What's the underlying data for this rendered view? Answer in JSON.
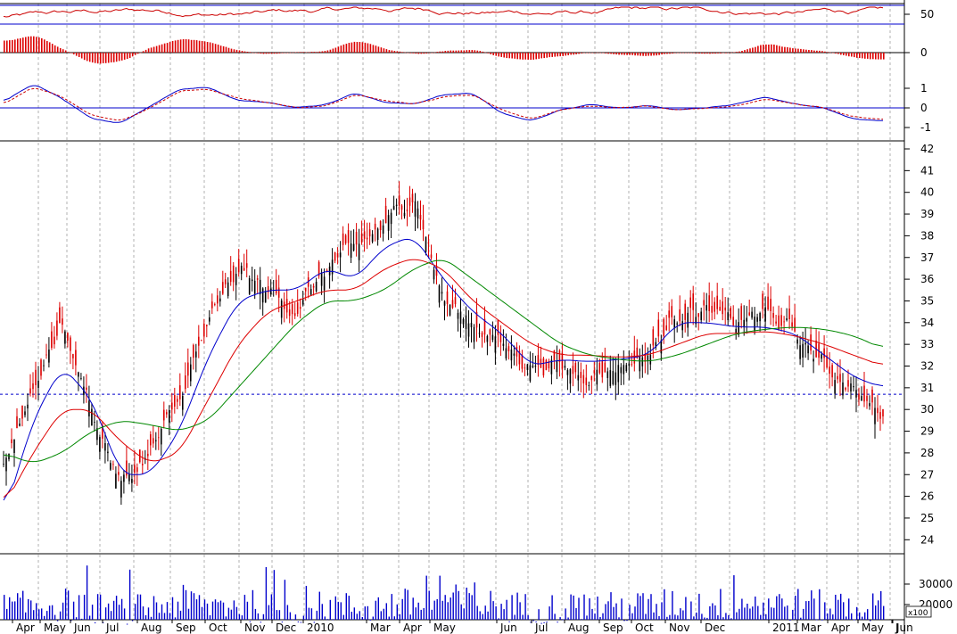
{
  "chart_data": [
    {
      "panel": "rsi",
      "type": "line",
      "y_ticks": [
        "50"
      ],
      "ylim": [
        0,
        100
      ],
      "reference_lines": [
        50,
        85
      ],
      "series_color": "#cc0000",
      "y_start": 60,
      "y_end": 53
    },
    {
      "panel": "macd-histogram",
      "type": "bar",
      "y_ticks": [
        "0"
      ],
      "series_color": "#dd0000",
      "values_by_month": [
        0.6,
        1.0,
        0.2,
        -0.6,
        -0.5,
        0.3,
        0.8,
        0.6,
        0.1,
        -0.1,
        0.0,
        0.1,
        0.7,
        0.2,
        -0.1,
        0.1,
        0.2,
        -0.3,
        -0.4,
        -0.2,
        0.0,
        -0.1,
        -0.2,
        0.0,
        -0.1,
        0.0,
        0.5,
        0.2,
        0.1,
        -0.3,
        -0.4
      ]
    },
    {
      "panel": "macd",
      "type": "line",
      "y_ticks": [
        "1",
        "0",
        "-1"
      ],
      "ylim": [
        -1.5,
        1.5
      ],
      "series": [
        {
          "color": "#0000cc",
          "values_by_month": [
            0.3,
            1.3,
            0.5,
            -0.6,
            -0.8,
            0.1,
            1.0,
            1.1,
            0.4,
            0.3,
            0.0,
            0.2,
            0.8,
            0.3,
            0.2,
            0.7,
            0.8,
            -0.3,
            -0.7,
            -0.1,
            0.2,
            0.0,
            0.1,
            -0.1,
            0.0,
            0.2,
            0.6,
            0.2,
            0.0,
            -0.6,
            -0.7
          ]
        },
        {
          "color": "#cc0000",
          "dashed": true,
          "values_by_month": [
            0.2,
            1.1,
            0.6,
            -0.4,
            -0.7,
            0.0,
            0.9,
            1.0,
            0.5,
            0.3,
            0.0,
            0.1,
            0.7,
            0.4,
            0.2,
            0.6,
            0.7,
            -0.1,
            -0.6,
            -0.1,
            0.1,
            0.0,
            0.1,
            -0.1,
            0.0,
            0.1,
            0.5,
            0.2,
            0.0,
            -0.5,
            -0.6
          ]
        }
      ]
    },
    {
      "panel": "price",
      "type": "candlestick",
      "y_ticks": [
        "42",
        "41",
        "40",
        "39",
        "38",
        "37",
        "36",
        "35",
        "34",
        "33",
        "32",
        "31",
        "30",
        "29",
        "28",
        "27",
        "26",
        "25",
        "24"
      ],
      "ylim": [
        23.5,
        42.5
      ],
      "reference_line": 30.7,
      "x_ticks": [
        "Apr",
        "May",
        "Jun",
        "Jul",
        "Aug",
        "Sep",
        "Oct",
        "Nov",
        "Dec",
        "2010",
        "Mar",
        "Apr",
        "May",
        "Jun",
        "Jul",
        "Aug",
        "Sep",
        "Oct",
        "Nov",
        "Dec",
        "2011",
        "Mar",
        "Apr",
        "May",
        "Jun",
        "J"
      ],
      "close_by_month": [
        27.5,
        31.0,
        34.0,
        30.0,
        26.5,
        28.0,
        30.5,
        34.0,
        36.5,
        35.5,
        34.5,
        36.5,
        37.5,
        38.5,
        40.0,
        35.0,
        34.0,
        33.0,
        32.0,
        32.0,
        31.5,
        32.0,
        32.5,
        34.5,
        34.5,
        34.0,
        34.5,
        33.5,
        32.0,
        31.0,
        29.5
      ],
      "series": [
        {
          "name": "",
          "color": "#0000cc",
          "values_by_month": [
            25.0,
            29.5,
            32.0,
            30.5,
            27.0,
            27.0,
            29.0,
            32.5,
            35.0,
            35.5,
            35.5,
            36.5,
            36.0,
            37.5,
            38.0,
            36.0,
            34.5,
            33.5,
            32.0,
            32.3,
            32.2,
            32.3,
            32.5,
            34.0,
            34.0,
            33.8,
            33.8,
            33.5,
            32.5,
            31.5,
            31.0
          ]
        },
        {
          "name": "",
          "color": "#dd0000",
          "values_by_month": [
            25.5,
            28.0,
            30.0,
            30.0,
            28.5,
            27.5,
            28.0,
            30.5,
            33.0,
            34.5,
            35.0,
            35.5,
            35.5,
            36.5,
            37.0,
            36.5,
            35.0,
            34.0,
            33.0,
            32.5,
            32.5,
            32.4,
            32.5,
            33.0,
            33.5,
            33.5,
            33.6,
            33.4,
            33.0,
            32.5,
            32.0
          ]
        },
        {
          "name": "",
          "color": "#008800",
          "values_by_month": [
            28.0,
            27.5,
            28.0,
            29.0,
            29.5,
            29.3,
            29.0,
            29.5,
            31.0,
            32.5,
            34.0,
            35.0,
            35.0,
            35.5,
            36.5,
            37.0,
            36.0,
            35.0,
            34.0,
            33.0,
            32.5,
            32.3,
            32.2,
            32.5,
            33.0,
            33.5,
            33.7,
            33.8,
            33.7,
            33.4,
            32.8
          ]
        }
      ]
    },
    {
      "panel": "volume",
      "type": "bar",
      "y_ticks": [
        "30000",
        "20000"
      ],
      "y_unit": "x100",
      "series_color": "#0000cc",
      "values_by_month": [
        20000,
        21000,
        22000,
        20000,
        19000,
        20000,
        23000,
        21000,
        22000,
        20000,
        19000,
        21000,
        20000,
        21000,
        22000,
        24000,
        22000,
        21000,
        20000,
        20000,
        21000,
        20000,
        21000,
        22000,
        21000,
        23000,
        22000,
        22000,
        21000,
        20000,
        21000
      ]
    }
  ]
}
